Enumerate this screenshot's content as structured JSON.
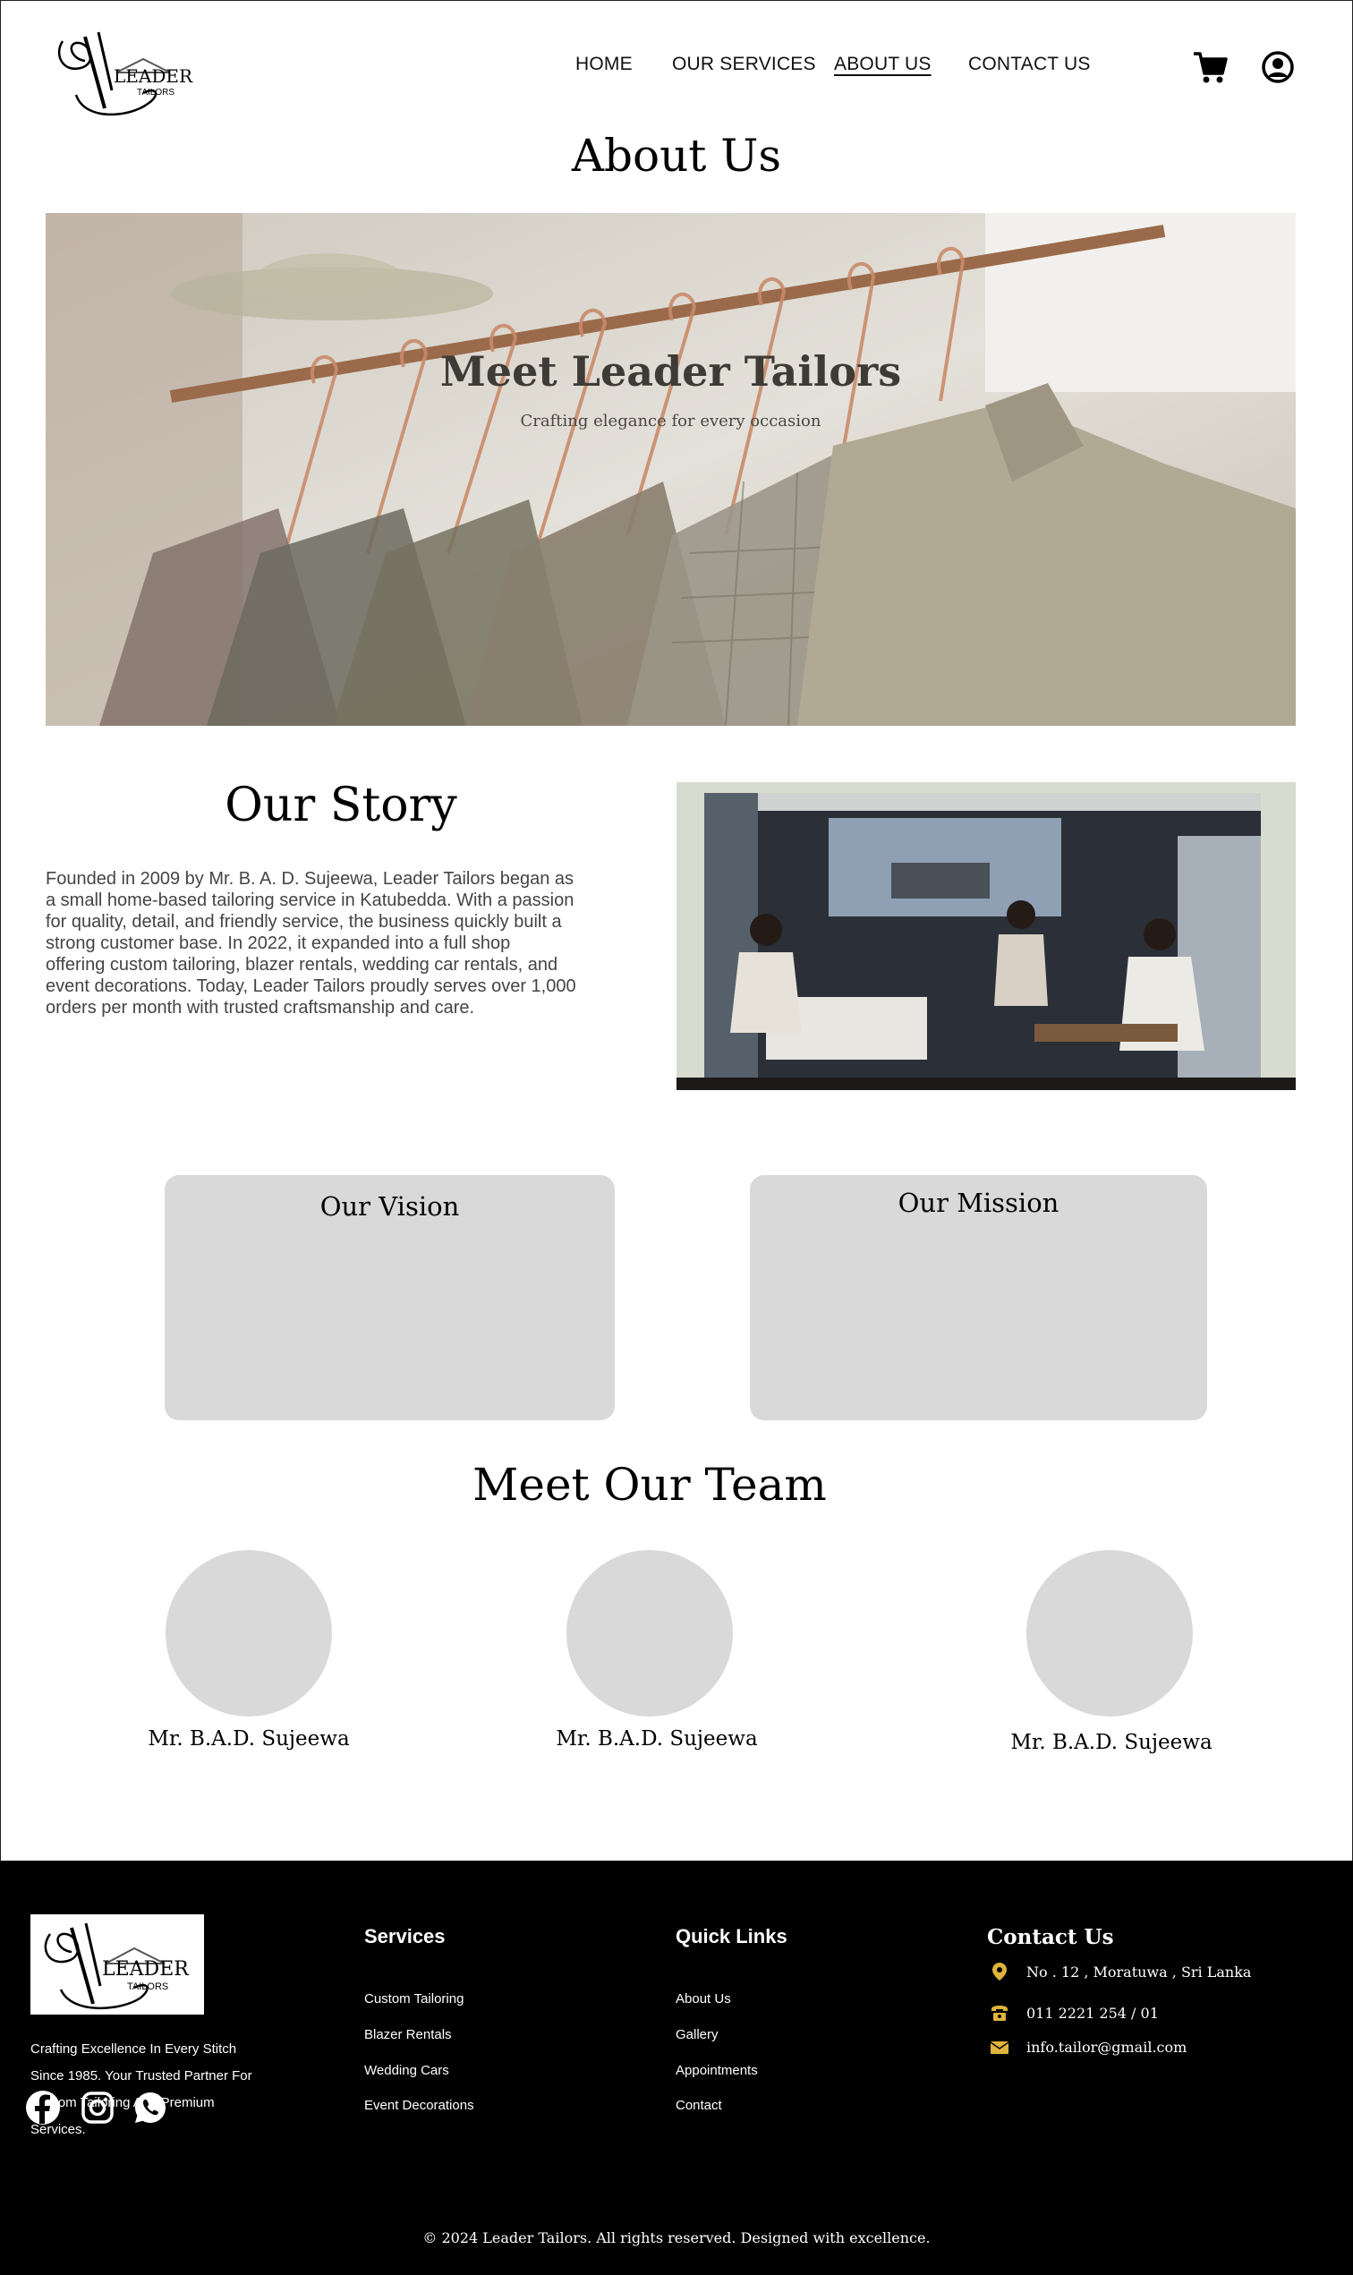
{
  "header": {
    "logo_alt": "Leader Tailors",
    "logo_word": "LEADER",
    "logo_small": "TAILORS",
    "nav": [
      {
        "label": "HOME"
      },
      {
        "label": "OUR SERVICES"
      },
      {
        "label": "ABOUT US",
        "active": true
      },
      {
        "label": "CONTACT US"
      }
    ],
    "icons": [
      "cart-icon",
      "user-account-icon"
    ]
  },
  "page": {
    "title": "About Us"
  },
  "hero": {
    "title": "Meet Leader Tailors",
    "subtitle": "Crafting elegance for every occasion"
  },
  "story": {
    "title": "Our Story",
    "text_lines": [
      "Founded in 2009 by Mr. B. A. D. Sujeewa, Leader Tailors began as",
      "a small home-based tailoring service in Katubedda. With a passion",
      "for quality, detail, and friendly service, the business quickly built a",
      "strong customer base. In 2022, it expanded into a full shop",
      "offering custom tailoring, blazer rentals, wedding car rentals, and",
      "event decorations. Today, Leader Tailors proudly serves over 1,000",
      "orders per month with trusted craftsmanship and care."
    ]
  },
  "vision": {
    "title": "Our Vision"
  },
  "mission": {
    "title": "Our Mission"
  },
  "team": {
    "title": "Meet Our Team",
    "members": [
      {
        "name": "Mr. B.A.D. Sujeewa"
      },
      {
        "name": "Mr. B.A.D. Sujeewa"
      },
      {
        "name": "Mr. B.A.D. Sujeewa"
      }
    ]
  },
  "footer": {
    "tagline_lines": [
      "Crafting Excellence In Every Stitch",
      "Since 1985. Your Trusted Partner For",
      "Custom Tailoring And Premium",
      "Services."
    ],
    "services": {
      "heading": "Services",
      "items": [
        "Custom Tailoring",
        "Blazer Rentals",
        "Wedding Cars",
        "Event Decorations"
      ]
    },
    "quick_links": {
      "heading": "Quick Links",
      "items": [
        "About Us",
        "Gallery",
        "Appointments",
        "Contact"
      ]
    },
    "contact": {
      "heading": "Contact Us",
      "address": "No . 12 ,  Moratuwa , Sri Lanka",
      "phone": "011 2221 254 / 01",
      "email": "info.tailor@gmail.com",
      "icon_color": "#e0b43a"
    },
    "social": [
      "facebook-icon",
      "instagram-icon",
      "whatsapp-icon"
    ],
    "copyright": "© 2024 Leader Tailors. All rights reserved. Designed with excellence."
  }
}
